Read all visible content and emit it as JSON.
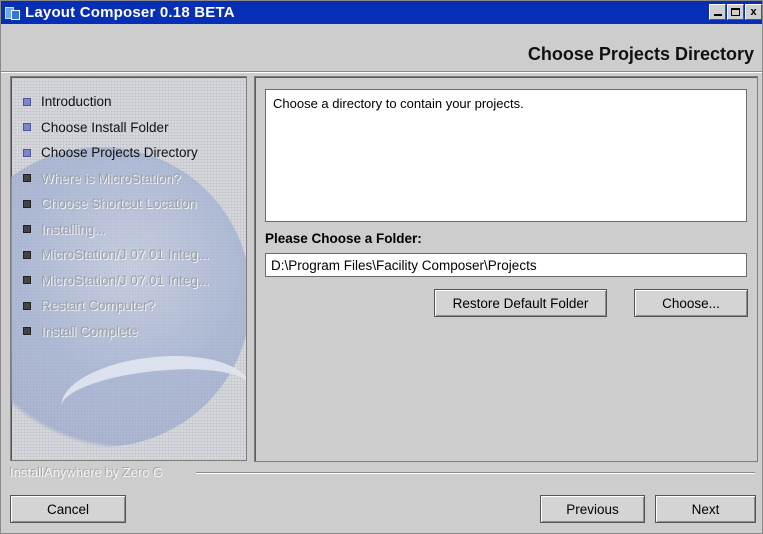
{
  "window": {
    "title": "Layout Composer 0.18 BETA",
    "controls": [
      "minimize",
      "maximize",
      "close"
    ],
    "close_glyph": "x"
  },
  "header": {
    "step_title": "Choose Projects Directory"
  },
  "sidebar": {
    "steps": [
      {
        "label": "Introduction",
        "state": "done"
      },
      {
        "label": "Choose Install Folder",
        "state": "done"
      },
      {
        "label": "Choose Projects Directory",
        "state": "current"
      },
      {
        "label": "Where is MicroStation?",
        "state": "todo"
      },
      {
        "label": "Choose Shortcut Location",
        "state": "todo"
      },
      {
        "label": "Installing...",
        "state": "todo"
      },
      {
        "label": "MicroStation/J 07.01 Integ...",
        "state": "todo"
      },
      {
        "label": "MicroStation/J 07.01 Integ...",
        "state": "todo"
      },
      {
        "label": "Restart Computer?",
        "state": "todo"
      },
      {
        "label": "Install Complete",
        "state": "todo"
      }
    ]
  },
  "main": {
    "description": "Choose a directory to contain your projects.",
    "folder_label": "Please Choose a Folder:",
    "folder_value": "D:\\Program Files\\Facility Composer\\Projects",
    "restore_button": "Restore Default Folder",
    "choose_button": "Choose..."
  },
  "footer": {
    "brand": "InstallAnywhere by Zero G",
    "cancel_button": "Cancel",
    "previous_button": "Previous",
    "next_button": "Next"
  },
  "colors": {
    "titlebar": "#062fb6",
    "window_bg": "#cdcdcd",
    "done_bullet": "#7e86c8",
    "todo_bullet": "#444444",
    "inactive_text": "#9aa0a8"
  }
}
